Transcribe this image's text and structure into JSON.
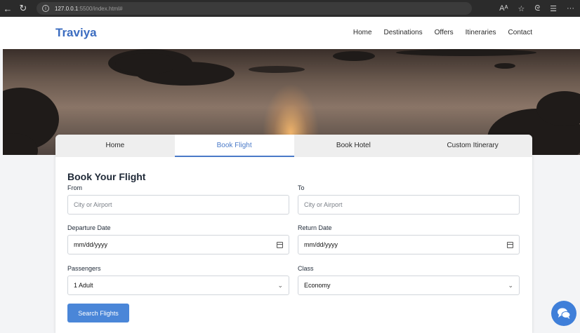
{
  "browser": {
    "url_host": "127.0.0.1",
    "url_path": ":5500/index.html#"
  },
  "site": {
    "logo": "Traviya",
    "nav": [
      "Home",
      "Destinations",
      "Offers",
      "Itineraries",
      "Contact"
    ]
  },
  "tabs": [
    {
      "label": "Home",
      "active": false
    },
    {
      "label": "Book Flight",
      "active": true
    },
    {
      "label": "Book Hotel",
      "active": false
    },
    {
      "label": "Custom Itinerary",
      "active": false
    }
  ],
  "form": {
    "title": "Book Your Flight",
    "from": {
      "label": "From",
      "placeholder": "City or Airport"
    },
    "to": {
      "label": "To",
      "placeholder": "City or Airport"
    },
    "departure": {
      "label": "Departure Date",
      "value": "mm/dd/yyyy"
    },
    "return": {
      "label": "Return Date",
      "value": "mm/dd/yyyy"
    },
    "passengers": {
      "label": "Passengers",
      "value": "1 Adult"
    },
    "class": {
      "label": "Class",
      "value": "Economy"
    },
    "submit": "Search Flights"
  },
  "colors": {
    "accent": "#4a7ac8",
    "button": "#4a86d8"
  }
}
